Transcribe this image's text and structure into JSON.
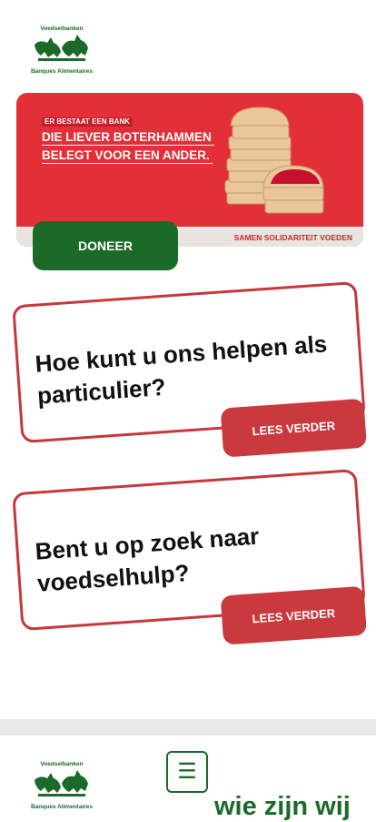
{
  "logo": {
    "top_text": "Voedselbanken",
    "bottom_text": "Banques Alimentaires"
  },
  "hero": {
    "line1": "ER BESTAAT EEN BANK",
    "line2": "DIE LIEVER BOTERHAMMEN",
    "line3": "BELEGT VOOR EEN ANDER.",
    "slogan": "SAMEN SOLIDARITEIT VOEDEN",
    "accent_color": "#e32f38"
  },
  "doneer": {
    "label": "DONEER",
    "color": "#1b6a27"
  },
  "cards": [
    {
      "question": "Hoe kunt u ons helpen als particulier?",
      "button": "LEES VERDER"
    },
    {
      "question": "Bent u op zoek naar voedselhulp?",
      "button": "LEES VERDER"
    }
  ],
  "footer": {
    "menu_icon": "hamburger-icon",
    "menu_glyph": "☰",
    "heading": "wie zijn wij"
  },
  "colors": {
    "brand_green": "#1b6a27",
    "card_red": "#c5383c"
  }
}
